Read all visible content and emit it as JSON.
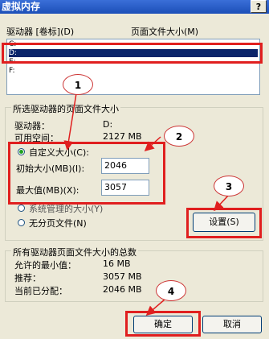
{
  "title": "虚拟内存",
  "help_label": "?",
  "drives_header": {
    "drive": "驱动器 [卷标](D)",
    "size": "页面文件大小(M)"
  },
  "drives": [
    {
      "name": "C:",
      "selected": false
    },
    {
      "name": "D:",
      "selected": true
    },
    {
      "name": "E:",
      "selected": false
    },
    {
      "name": "F:",
      "selected": false
    }
  ],
  "selected_drive_group": {
    "legend": "所选驱动器的页面文件大小",
    "drive_label": "驱动器：",
    "drive_value": "D:",
    "free_label": "可用空间：",
    "free_value": "2127 MB",
    "custom_size_label": "自定义大小(C):",
    "initial_label": "初始大小(MB)(I):",
    "initial_value": "2046",
    "max_label": "最大值(MB)(X):",
    "max_value": "3057",
    "system_managed_label": "系统管理的大小(Y)",
    "no_paging_label": "无分页文件(N)",
    "set_button": "设置(S)"
  },
  "totals_group": {
    "legend": "所有驱动器页面文件大小的总数",
    "min_label": "允许的最小值：",
    "min_value": "16 MB",
    "recommended_label": "推荐：",
    "recommended_value": "3057 MB",
    "allocated_label": "当前已分配：",
    "allocated_value": "2046 MB"
  },
  "buttons": {
    "ok": "确定",
    "cancel": "取消"
  },
  "callouts": [
    "1",
    "2",
    "3",
    "4"
  ],
  "colors": {
    "annotation": "#e01f1f",
    "selection": "#0a246a",
    "title_bar": "#1c4fb8"
  }
}
